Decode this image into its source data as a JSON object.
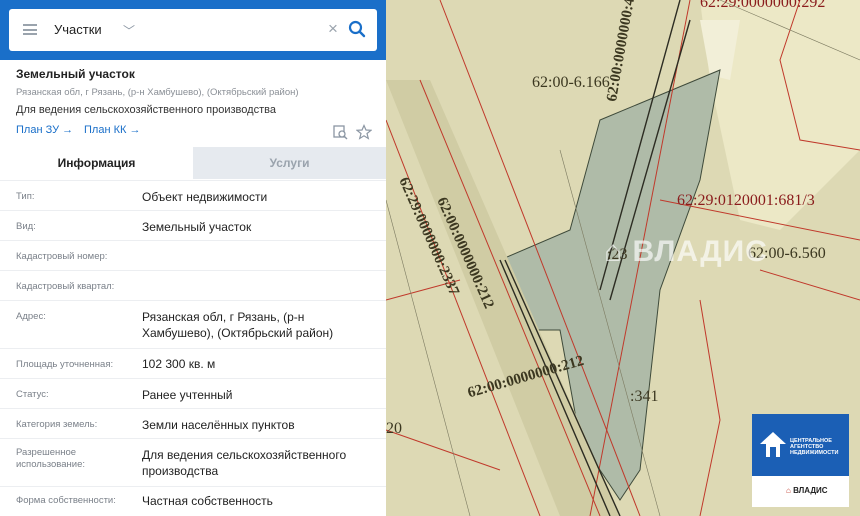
{
  "search": {
    "category": "Участки"
  },
  "object": {
    "title": "Земельный участок",
    "address_line": "Рязанская обл, г Рязань, (р-н Хамбушево), (Октябрьский район)",
    "purpose": "Для ведения сельскохозяйственного производства",
    "plan_zu": "План ЗУ →",
    "plan_kk": "План КК →"
  },
  "tabs": [
    {
      "label": "Информация"
    },
    {
      "label": "Услуги"
    }
  ],
  "info_rows": [
    {
      "key": "Тип:",
      "value": "Объект недвижимости"
    },
    {
      "key": "Вид:",
      "value": "Земельный участок"
    },
    {
      "key": "Кадастровый номер:",
      "value": ""
    },
    {
      "key": "Кадастровый квартал:",
      "value": ""
    },
    {
      "key": "Адрес:",
      "value": "Рязанская обл, г Рязань, (р-н Хамбушево), (Октябрьский район)"
    },
    {
      "key": "Площадь уточненная:",
      "value": "102 300 кв. м"
    },
    {
      "key": "Статус:",
      "value": "Ранее учтенный"
    },
    {
      "key": "Категория земель:",
      "value": "Земли населённых пунктов"
    },
    {
      "key": "Разрешенное использование:",
      "value": "Для ведения сельскохозяйственного производства"
    },
    {
      "key": "Форма собственности:",
      "value": "Частная собственность"
    }
  ],
  "map_labels": {
    "top_right": "62:29:0000000:292",
    "quarter1": "62:00-6.166",
    "vertical1": "62:00:0000000:4",
    "cad_red": "62:29:0120001:681/3",
    "quarter2": "62:00-6.560",
    "parcel23": ":23",
    "diag1": "62:29:0000000:2337",
    "diag2": "62:00:0000000:212",
    "diag3": "62:00:0000000:212",
    "parcel341": ":341",
    "left20": "20"
  },
  "logo": {
    "line1": "ЦЕНТРАЛЬНОЕ АГЕНТСТВО НЕДВИЖИМОСТИ",
    "brand": "ВЛАДИС"
  },
  "watermark": "ВЛАДИС",
  "colors": {
    "header_blue": "#1a6fc9",
    "map_bg": "#ddd9b4",
    "parcel_fill": "#a7b5a6"
  }
}
